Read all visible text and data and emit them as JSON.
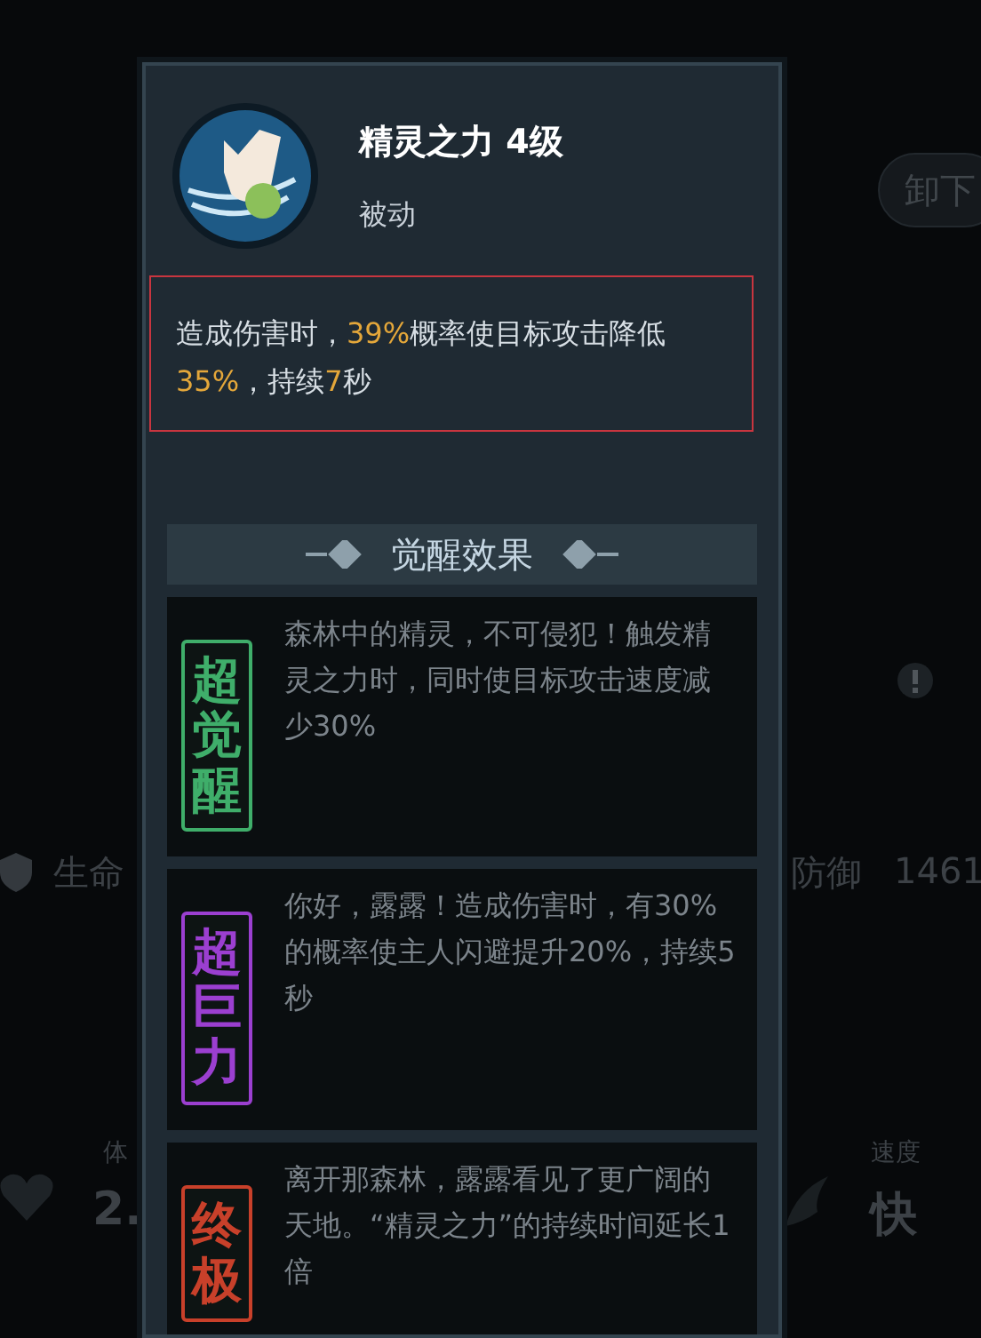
{
  "background": {
    "unload_button": "卸下",
    "stats": [
      {
        "kind": "inline",
        "label": "生命"
      },
      {
        "kind": "inline",
        "label": "防御",
        "value": "1461"
      },
      {
        "kind": "stacked",
        "label": "体",
        "value": "2."
      },
      {
        "kind": "stacked",
        "label": "速度",
        "value": "快"
      }
    ]
  },
  "skill": {
    "name": "精灵之力 4级",
    "type": "被动",
    "description": "造成伤害时，**39%**概率使目标攻击降低**35%**，持续**7**秒"
  },
  "awakening": {
    "title": "觉醒效果",
    "effects": [
      {
        "badge": "超觉醒",
        "color": "#3fae6a",
        "text": "森林中的精灵，不可侵犯！触发精灵之力时，同时使目标攻击速度减少30%"
      },
      {
        "badge": "超巨力",
        "color": "#9b3fd0",
        "text": "你好，露露！造成伤害时，有30%的概率使主人闪避提升20%，持续5秒"
      },
      {
        "badge": "终极",
        "color": "#c8402a",
        "text": "离开那森林，露露看见了更广阔的天地。“精灵之力”的持续时间延长1倍"
      }
    ]
  }
}
